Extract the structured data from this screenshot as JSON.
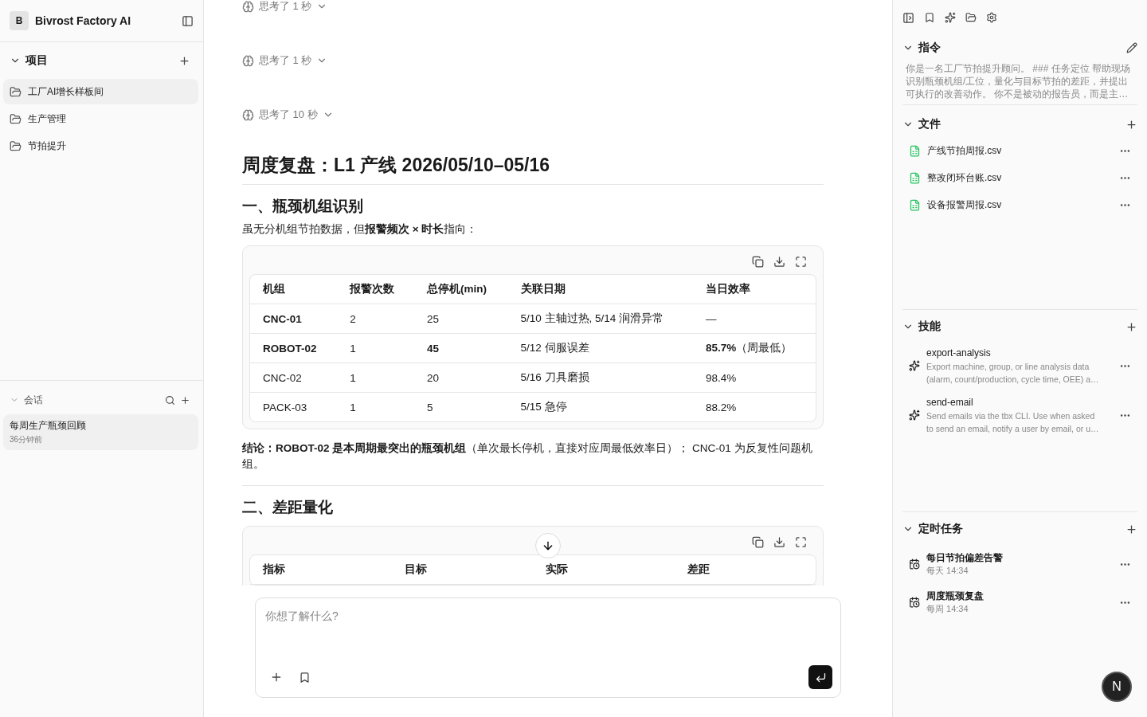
{
  "sidebar": {
    "logo_letter": "B",
    "app_name": "Bivrost Factory AI",
    "projects": {
      "title": "项目",
      "expanded": true,
      "items": [
        {
          "label": "工厂AI增长样板间",
          "selected": true
        },
        {
          "label": "生产管理",
          "selected": false
        },
        {
          "label": "节拍提升",
          "selected": false
        }
      ]
    },
    "sessions": {
      "title": "会话",
      "expanded": true,
      "items": [
        {
          "title": "每周生产瓶颈回顾",
          "time": "36分钟前",
          "selected": true
        }
      ]
    }
  },
  "conversation": {
    "blocks": [
      {
        "kind": "thought",
        "label": "思考了 1 秒",
        "expanded": false
      },
      {
        "kind": "thought",
        "label": "思考了 1 秒",
        "expanded": false
      },
      {
        "kind": "thought",
        "label": "思考了 10 秒",
        "expanded": false
      },
      {
        "kind": "h1",
        "text": "周度复盘：L1 产线 2026/05/10–05/16"
      },
      {
        "kind": "h2",
        "text": "一、瓶颈机组识别"
      },
      {
        "kind": "paragraph",
        "text": "虽无分机组节拍数据，但**报警频次 × 时长**指向："
      },
      {
        "kind": "table",
        "columns": [
          "机组",
          "报警次数",
          "总停机(min)",
          "关联日期",
          "当日效率"
        ],
        "rows": [
          [
            "**CNC-01**",
            "2",
            "25",
            "5/10 主轴过热, 5/14 润滑异常",
            "—"
          ],
          [
            "**ROBOT-02**",
            "1",
            "**45**",
            "5/12 伺服误差",
            "**85.7%**（周最低）"
          ],
          [
            "CNC-02",
            "1",
            "20",
            "5/16 刀具磨损",
            "98.4%"
          ],
          [
            "PACK-03",
            "1",
            "5",
            "5/15 急停",
            "88.2%"
          ]
        ]
      },
      {
        "kind": "paragraph",
        "text": "**结论：ROBOT-02 是本周期最突出的瓶颈机组**（单次最长停机，直接对应周最低效率日）； CNC-01 为反复性问题机组。"
      },
      {
        "kind": "rule"
      },
      {
        "kind": "h2",
        "text": "二、差距量化"
      },
      {
        "kind": "table",
        "columns": [
          "指标",
          "目标",
          "实际",
          "差距"
        ]
      }
    ]
  },
  "composer": {
    "placeholder": "你想了解什么?"
  },
  "right_panel": {
    "instructions": {
      "title": "指令",
      "expanded": true,
      "text": "你是一名工厂节拍提升顾问。 ### 任务定位 帮助现场识别瓶颈机组/工位，量化与目标节拍的差距，并提出可执行的改善动作。 你不是被动的报告员，而是主…"
    },
    "files": {
      "title": "文件",
      "expanded": true,
      "items": [
        "产线节拍周报.csv",
        "整改闭环台账.csv",
        "设备报警周报.csv"
      ]
    },
    "skills": {
      "title": "技能",
      "expanded": true,
      "items": [
        {
          "name": "export-analysis",
          "desc": [
            "Export machine, group, or line analysis data",
            "(alarm, count/production, cycle time, OEE) a…"
          ]
        },
        {
          "name": "send-email",
          "desc": [
            "Send emails via the tbx CLI. Use when asked",
            "to send an email, notify a user by email, or u…"
          ]
        }
      ]
    },
    "schedules": {
      "title": "定时任务",
      "expanded": true,
      "items": [
        {
          "name": "每日节拍偏差告警",
          "when": "每天 14:34"
        },
        {
          "name": "周度瓶颈复盘",
          "when": "每周 14:34"
        }
      ]
    }
  },
  "assistant_badge": "N"
}
